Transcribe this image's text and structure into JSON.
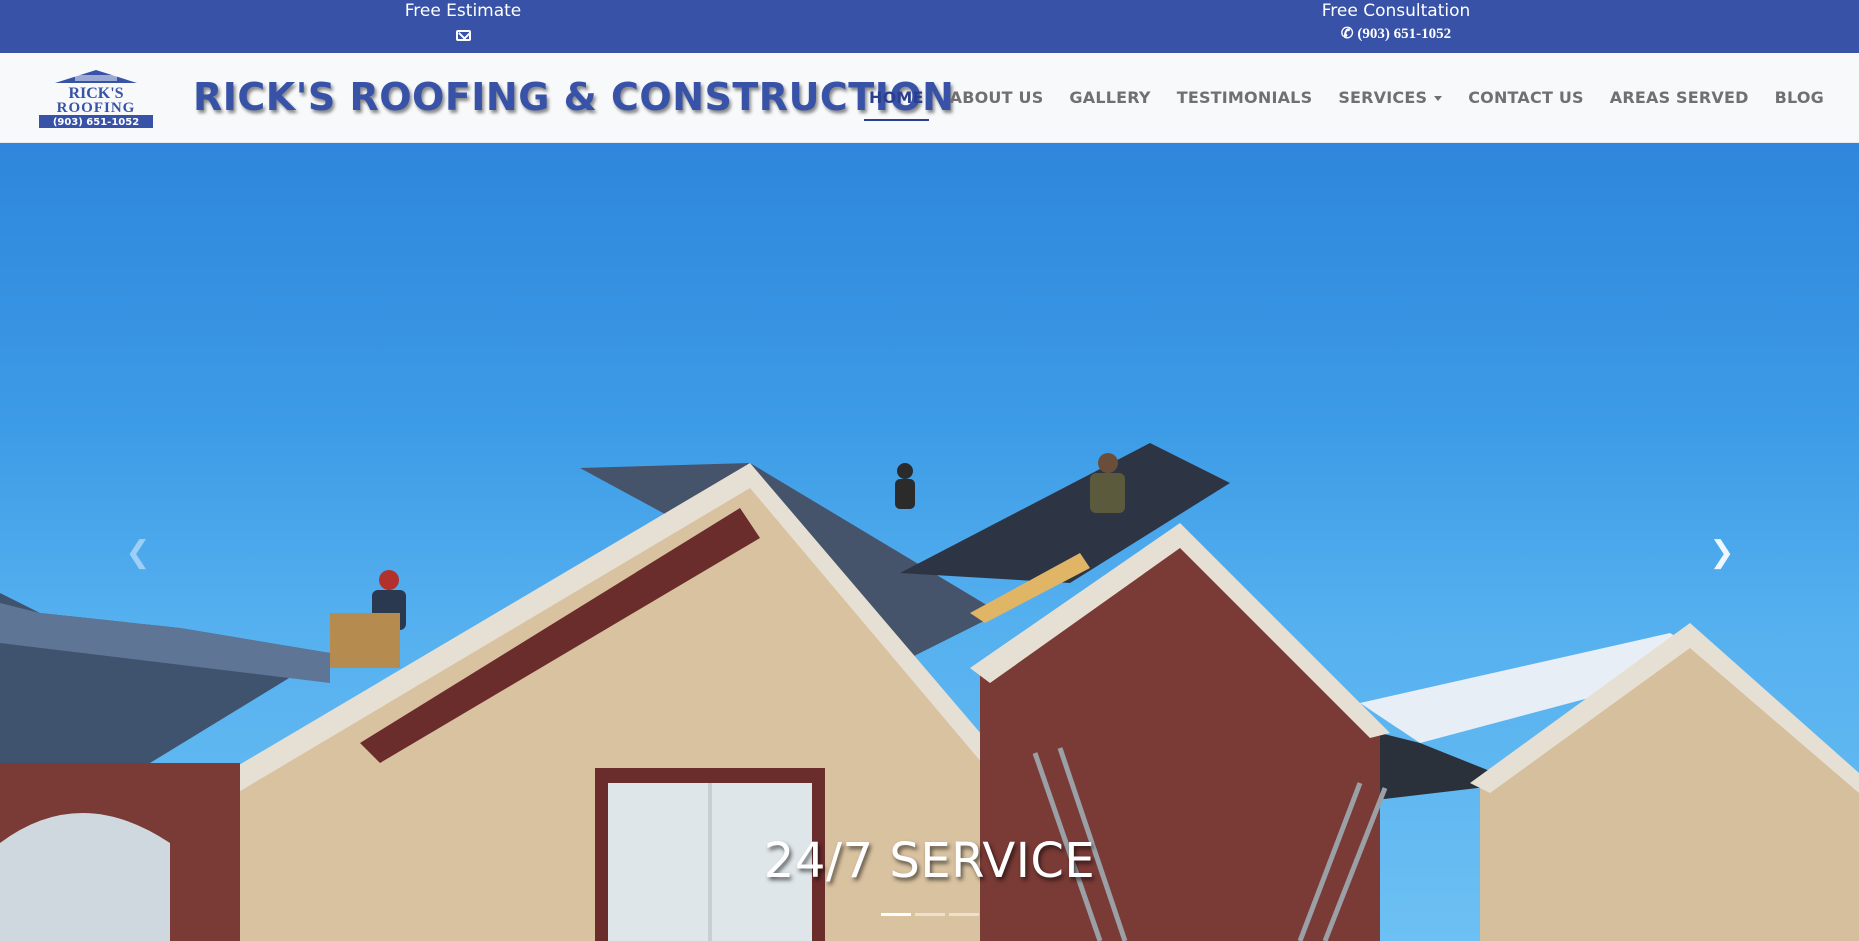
{
  "topbar": {
    "estimate_label": "Free Estimate",
    "consult_label": "Free Consultation",
    "phone": "(903) 651-1052",
    "icons": [
      "envelope-icon",
      "phone-icon"
    ]
  },
  "brand": {
    "logo_line1": "RICK'S",
    "logo_line2": "ROOFING",
    "logo_phone": "(903) 651-1052",
    "title": "RICK'S ROOFING & CONSTRUCTION"
  },
  "nav": {
    "items": [
      {
        "label": "HOME"
      },
      {
        "label": "ABOUT US"
      },
      {
        "label": "GALLERY"
      },
      {
        "label": "TESTIMONIALS"
      },
      {
        "label": "SERVICES"
      },
      {
        "label": "CONTACT US"
      },
      {
        "label": "AREAS SERVED"
      },
      {
        "label": "BLOG"
      }
    ],
    "active": "HOME"
  },
  "hero": {
    "caption": "24/7 SERVICE",
    "prev_icon": "chevron-left-icon",
    "next_icon": "chevron-right-icon",
    "slides": 3,
    "active_slide": 1
  },
  "colors": {
    "topbar": "#3752a7",
    "brand": "#3752a7",
    "nav_active": "#2a3f8f",
    "nav_text": "#707070"
  }
}
